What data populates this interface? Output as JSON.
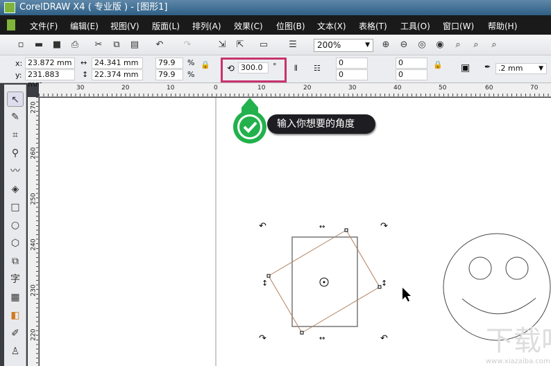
{
  "window": {
    "title": "CorelDRAW X4 ( 专业版 ) - [图形1]"
  },
  "menu": [
    "文件(F)",
    "编辑(E)",
    "视图(V)",
    "版面(L)",
    "排列(A)",
    "效果(C)",
    "位图(B)",
    "文本(X)",
    "表格(T)",
    "工具(O)",
    "窗口(W)",
    "帮助(H)"
  ],
  "toolbar": {
    "zoom": "200%"
  },
  "props": {
    "x_label": "x:",
    "x": "23.872 mm",
    "y_label": "y:",
    "y": "231.883 mm",
    "width": "24.341 mm",
    "height": "22.374 mm",
    "scale_x": "79.9",
    "scale_y": "79.9",
    "pct": "%",
    "rotation": "300.0",
    "deg": "°",
    "pos1": "0",
    "pos2": "0",
    "pos3": "0",
    "pos4": "0",
    "outline": ".2 mm"
  },
  "ruler": {
    "h": [
      "30",
      "20",
      "10",
      "0",
      "10",
      "20",
      "30",
      "40",
      "50",
      "60",
      "70"
    ],
    "v": [
      "270",
      "260",
      "250",
      "240",
      "230",
      "220"
    ]
  },
  "callout": "输入你想要的角度",
  "watermark": "下载吧 www.xiazaiba.com",
  "colors": {
    "highlight": "#c8326e",
    "green": "#22b14c",
    "rotated": "#b08060"
  }
}
